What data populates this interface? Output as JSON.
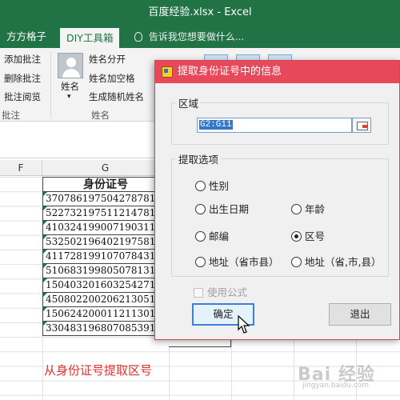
{
  "window": {
    "title": "百度经验.xlsx - Excel"
  },
  "tabs": [
    {
      "label": "方方格子"
    },
    {
      "label": "DIY工具箱"
    }
  ],
  "tell_me": "告诉我您想要做什么...",
  "ribbon": {
    "comment_group": {
      "label": "批注",
      "items": [
        "添加批注",
        "删除批注",
        "批注阅览"
      ]
    },
    "name_group": {
      "label": "姓名",
      "big_button": "姓名",
      "items": [
        "姓名分开",
        "姓名加空格",
        "生成随机姓名"
      ]
    }
  },
  "sheet": {
    "columns": [
      "F",
      "G"
    ],
    "header": "身份证号",
    "ids": [
      "370786197504278781",
      "522732197511214781",
      "410324199007190311",
      "532502196402197581",
      "411728199107078431",
      "510683199805078131",
      "150403201603254271",
      "450802200206213051",
      "150624200011211301",
      "330483196807085391"
    ],
    "caption": "从身份证号提取区号"
  },
  "dialog": {
    "title": "提取身份证号中的信息",
    "region_label": "区域",
    "range_value": "G2:G11",
    "options_label": "提取选项",
    "options": [
      {
        "label": "性别",
        "selected": false
      },
      {
        "label": "出生日期",
        "selected": false
      },
      {
        "label": "年龄",
        "selected": false
      },
      {
        "label": "邮编",
        "selected": false
      },
      {
        "label": "区号",
        "selected": true
      },
      {
        "label": "地址（省市县）",
        "selected": false
      },
      {
        "label": "地址（省,市,县）",
        "selected": false
      }
    ],
    "use_formula": "使用公式",
    "ok": "确定",
    "exit": "退出"
  },
  "watermark": {
    "text": "Bai 经验",
    "sub": "jingyan.baidu.com"
  }
}
